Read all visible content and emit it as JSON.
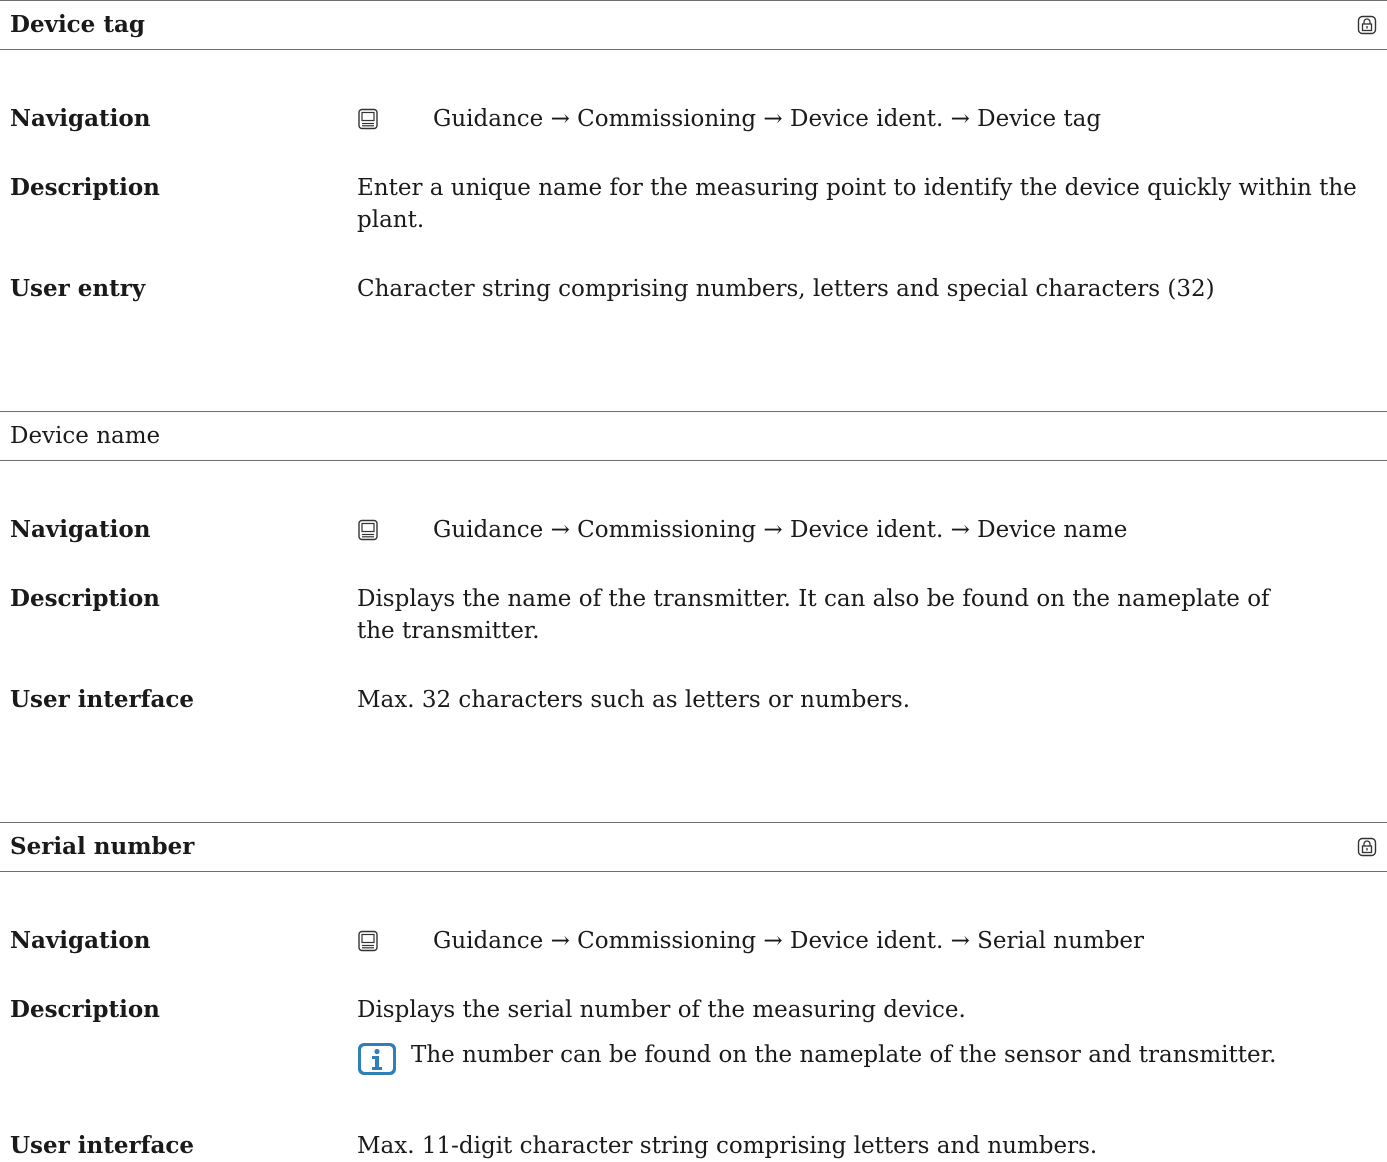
{
  "labels": {
    "navigation": "Navigation",
    "description": "Description",
    "user_entry": "User entry",
    "user_interface": "User interface"
  },
  "nav_arrow": "→",
  "sections": [
    {
      "title": "Device tag",
      "locked": true,
      "navigation": "Guidance → Commissioning → Device ident. → Device tag",
      "description": "Enter a unique name for the measuring point to identify the device quickly within the plant.",
      "user_entry": "Character string comprising numbers, letters and special characters (32)"
    },
    {
      "title": "Device name",
      "locked": false,
      "navigation": "Guidance → Commissioning → Device ident. → Device name",
      "description": "Displays the name of the transmitter. It can also be found on the nameplate of the transmitter.",
      "user_interface": "Max. 32 characters such as letters or numbers."
    },
    {
      "title": "Serial number",
      "locked": true,
      "navigation": "Guidance → Commissioning → Device ident. → Serial number",
      "description": "Displays the serial number of the measuring device.",
      "note": "The number can be found on the nameplate of the sensor and transmitter.",
      "user_interface": "Max. 11-digit character string comprising letters and numbers."
    }
  ],
  "icons": {
    "lock": "lock-icon",
    "navigation": "display-module-icon",
    "info": "info-icon"
  },
  "colors": {
    "info_icon": "#2f7fb8",
    "rule": "#6e6e6e"
  }
}
